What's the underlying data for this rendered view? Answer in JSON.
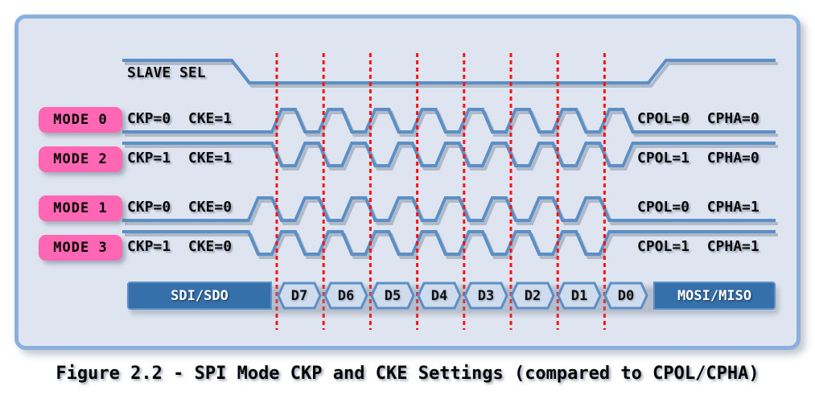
{
  "figure": {
    "caption": "Figure 2.2 - SPI Mode CKP and CKE Settings (compared to CPOL/CPHA)",
    "background_color": "#dfe5f0",
    "border_color": "#8cb0de",
    "wave_color": "#5b8fc6",
    "badge_color": "#ff66b3",
    "dash_color": "#ff1111",
    "bar_color": "#3570ab"
  },
  "slave_select": {
    "label": "SLAVE SEL",
    "initial_state": "high",
    "active_state": "low",
    "final_state": "high"
  },
  "modes": [
    {
      "badge": "MODE 0",
      "left_label": "CKP=0  CKE=1",
      "right_label": "CPOL=0  CPHA=0",
      "ckp": 0,
      "cke": 1,
      "cpol": 0,
      "cpha": 0,
      "idle_level": "low",
      "phase": "aligned"
    },
    {
      "badge": "MODE 2",
      "left_label": "CKP=1  CKE=1",
      "right_label": "CPOL=1  CPHA=0",
      "ckp": 1,
      "cke": 1,
      "cpol": 1,
      "cpha": 0,
      "idle_level": "high",
      "phase": "aligned"
    },
    {
      "badge": "MODE 1",
      "left_label": "CKP=0  CKE=0",
      "right_label": "CPOL=0  CPHA=1",
      "ckp": 0,
      "cke": 0,
      "cpol": 0,
      "cpha": 1,
      "idle_level": "low",
      "phase": "shifted"
    },
    {
      "badge": "MODE 3",
      "left_label": "CKP=1  CKE=0",
      "right_label": "CPOL=1  CPHA=1",
      "ckp": 1,
      "cke": 0,
      "cpol": 1,
      "cpha": 1,
      "idle_level": "high",
      "phase": "shifted"
    }
  ],
  "data_bar": {
    "left_label": "SDI/SDO",
    "right_label": "MOSI/MISO",
    "bits": [
      "D7",
      "D6",
      "D5",
      "D4",
      "D3",
      "D2",
      "D1",
      "D0"
    ]
  },
  "sample_lines": {
    "count": 8,
    "color": "#ff1111",
    "style": "dashed"
  }
}
